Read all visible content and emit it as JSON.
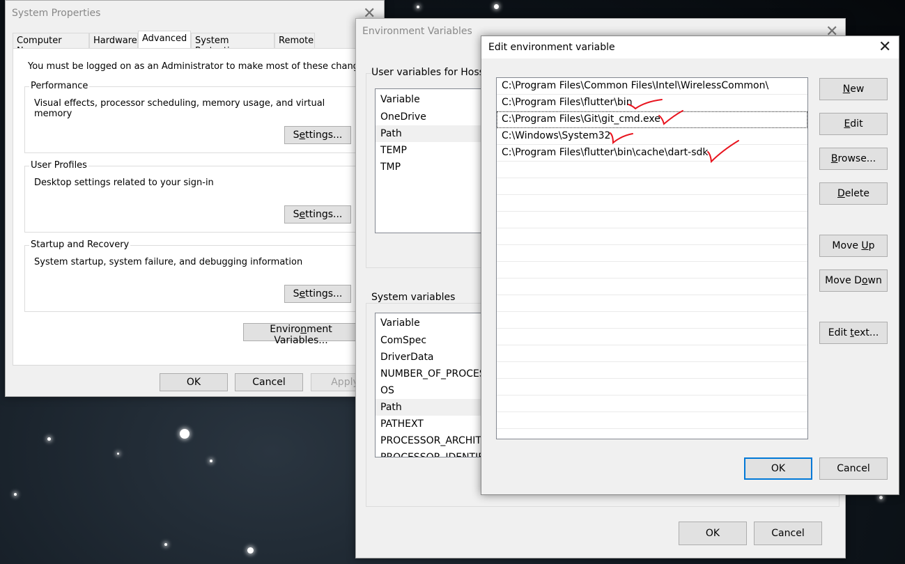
{
  "system_properties": {
    "title": "System Properties",
    "tabs": [
      "Computer Name",
      "Hardware",
      "Advanced",
      "System Protection",
      "Remote"
    ],
    "admin_note": "You must be logged on as an Administrator to make most of these changes.",
    "performance": {
      "label": "Performance",
      "description": "Visual effects, processor scheduling, memory usage, and virtual memory"
    },
    "user_profiles": {
      "label": "User Profiles",
      "description": "Desktop settings related to your sign-in"
    },
    "startup_recovery": {
      "label": "Startup and Recovery",
      "description": "System startup, system failure, and debugging information"
    },
    "settings_pre": "S",
    "settings_ul": "e",
    "settings_post": "ttings...",
    "env_pre": "Enviro",
    "env_ul": "n",
    "env_post": "ment Variables...",
    "ok_label": "OK",
    "cancel_label": "Cancel",
    "apply_label": "Apply"
  },
  "environment_variables": {
    "title": "Environment Variables",
    "user_section_label": "User variables for Hosse",
    "user_vars": [
      "Variable",
      "OneDrive",
      "Path",
      "TEMP",
      "TMP"
    ],
    "system_section_label": "System variables",
    "system_vars": [
      "Variable",
      "ComSpec",
      "DriverData",
      "NUMBER_OF_PROCES",
      "OS",
      "Path",
      "PATHEXT",
      "PROCESSOR_ARCHITE",
      "PROCESSOR_IDENTIFI"
    ],
    "ok_label": "OK",
    "cancel_label": "Cancel"
  },
  "edit_env": {
    "title": "Edit environment variable",
    "paths": [
      "C:\\Program Files\\Common Files\\Intel\\WirelessCommon\\",
      "C:\\Program Files\\flutter\\bin",
      "C:\\Program Files\\Git\\git_cmd.exe",
      "C:\\Windows\\System32",
      "C:\\Program Files\\flutter\\bin\\cache\\dart-sdk"
    ],
    "buttons": {
      "new": {
        "pre": "",
        "ul": "N",
        "post": "ew"
      },
      "edit": {
        "pre": "",
        "ul": "E",
        "post": "dit"
      },
      "browse": {
        "pre": "",
        "ul": "B",
        "post": "rowse..."
      },
      "delete": {
        "pre": "",
        "ul": "D",
        "post": "elete"
      },
      "move_up": {
        "pre": "Move ",
        "ul": "U",
        "post": "p"
      },
      "move_down": {
        "pre": "Move D",
        "ul": "o",
        "post": "wn"
      },
      "edit_text": {
        "pre": "Edit ",
        "ul": "t",
        "post": "ext..."
      }
    },
    "ok_label": "OK",
    "cancel_label": "Cancel",
    "annotation_color": "#e8141e"
  }
}
